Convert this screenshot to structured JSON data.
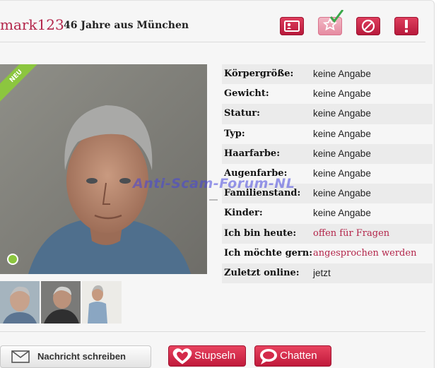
{
  "profile": {
    "username": "mark123",
    "subtitle": "46 Jahre aus München",
    "new_badge": "NEU"
  },
  "header_actions": [
    {
      "icon": "id-card-icon"
    },
    {
      "icon": "star-checkmark-icon"
    },
    {
      "icon": "block-icon"
    },
    {
      "icon": "exclamation-icon"
    }
  ],
  "details": [
    {
      "label": "Körpergröße:",
      "value": "keine Angabe"
    },
    {
      "label": "Gewicht:",
      "value": "keine Angabe"
    },
    {
      "label": "Statur:",
      "value": "keine Angabe"
    },
    {
      "label": "Typ:",
      "value": "keine Angabe"
    },
    {
      "label": "Haarfarbe:",
      "value": "keine Angabe"
    },
    {
      "label": "Augenfarbe:",
      "value": "keine Angabe"
    },
    {
      "label": "Familienstand:",
      "value": "keine Angabe"
    },
    {
      "label": "Kinder:",
      "value": "keine Angabe"
    },
    {
      "label": "Ich bin heute:",
      "value": "offen für Fragen"
    },
    {
      "label": "Ich möchte gern:",
      "value": "angesprochen werden"
    },
    {
      "label": "Zuletzt online:",
      "value": "jetzt"
    }
  ],
  "watermark": "Anti-Scam-Forum-NL",
  "buttons": {
    "message": "Nachricht schreiben",
    "wink": "Stupseln",
    "chat": "Chatten"
  },
  "colors": {
    "accent": "#b3254a",
    "badge": "#8cc63f",
    "button_red": "#d42a4a"
  }
}
